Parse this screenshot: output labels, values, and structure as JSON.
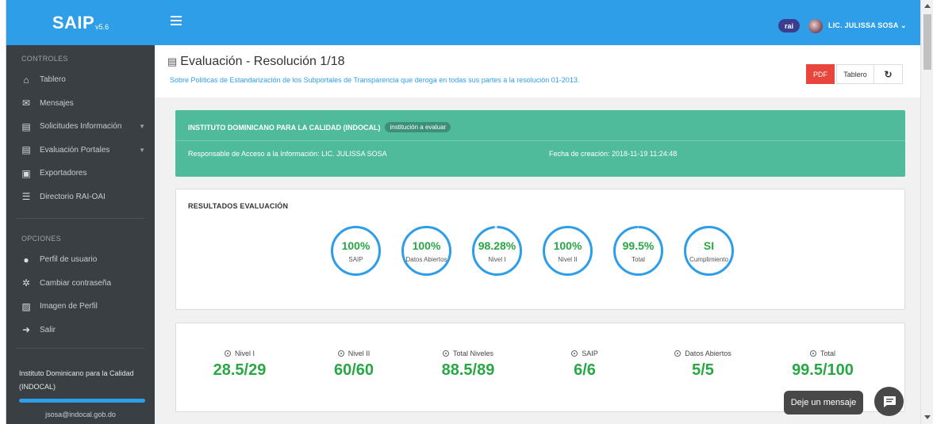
{
  "brand": {
    "name": "SAIP",
    "version": "v5.6"
  },
  "sidebar": {
    "section_controls": "CONTROLES",
    "controls": [
      {
        "label": "Tablero",
        "icon": "home-icon",
        "glyph": "⌂"
      },
      {
        "label": "Mensajes",
        "icon": "envelope-icon",
        "glyph": "✉"
      },
      {
        "label": "Solicitudes Información",
        "icon": "pdf-file-icon",
        "glyph": "▤"
      },
      {
        "label": "Evaluación Portales",
        "icon": "document-icon",
        "glyph": "▤"
      },
      {
        "label": "Exportadores",
        "icon": "save-icon",
        "glyph": "▣"
      },
      {
        "label": "Directorio RAI-OAI",
        "icon": "list-icon",
        "glyph": "☰"
      }
    ],
    "section_options": "OPCIONES",
    "options": [
      {
        "label": "Perfil de usuario",
        "icon": "user-icon",
        "glyph": "●"
      },
      {
        "label": "Cambiar contraseña",
        "icon": "cogs-icon",
        "glyph": "✲"
      },
      {
        "label": "Imagen de Perfil",
        "icon": "image-icon",
        "glyph": "▨"
      },
      {
        "label": "Salir",
        "icon": "sign-out-icon",
        "glyph": "➜"
      }
    ],
    "org_name": "Instituto Dominicano para la Calidad (INDOCAL)",
    "org_progress": 1.0,
    "email": "jsosa@indocal.gob.do"
  },
  "topbar": {
    "rai_badge": "rai",
    "user_name": "LIC. JULISSA SOSA",
    "user_caret": "⌄"
  },
  "header": {
    "title": "Evaluación - Resolución 1/18",
    "subtitle": "Sobre Políticas de Estandarización de los Subportales de Transparencia que deroga en todas sus partes a la resolución 01-2013.",
    "pdf_label": "PDF",
    "tablero_label": "Tablero",
    "refresh_glyph": "↻"
  },
  "institution": {
    "name": "INSTITUTO DOMINICANO PARA LA CALIDAD (INDOCAL)",
    "badge": "institución a evaluar",
    "responsable": "Responsable de Acceso a la Información: LIC. JULISSA SOSA",
    "fecha": "Fecha de creación: 2018-11-19 11:24:48"
  },
  "results": {
    "title": "RESULTADOS EVALUACIÓN",
    "gauges": [
      {
        "value": "100%",
        "label": "SAIP",
        "fraction": 1.0
      },
      {
        "value": "100%",
        "label": "Datos Abiertos",
        "fraction": 1.0
      },
      {
        "value": "98.28%",
        "label": "Nivel I",
        "fraction": 0.9828
      },
      {
        "value": "100%",
        "label": "Nivel II",
        "fraction": 1.0
      },
      {
        "value": "99.5%",
        "label": "Total",
        "fraction": 0.995
      },
      {
        "value": "SI",
        "label": "Cumplimiento",
        "fraction": 1.0
      }
    ]
  },
  "stats": [
    {
      "label": "Nivel I",
      "value": "28.5/29"
    },
    {
      "label": "Nivel II",
      "value": "60/60"
    },
    {
      "label": "Total Niveles",
      "value": "88.5/89"
    },
    {
      "label": "SAIP",
      "value": "6/6"
    },
    {
      "label": "Datos Abiertos",
      "value": "5/5"
    },
    {
      "label": "Total",
      "value": "99.5/100"
    }
  ],
  "chat": {
    "label": "Deje un mensaje"
  },
  "colors": {
    "primary": "#2e9ee8",
    "sidebar": "#3a3f44",
    "success": "#28a745",
    "info_card": "#4fbb9b",
    "danger": "#e8453c"
  }
}
